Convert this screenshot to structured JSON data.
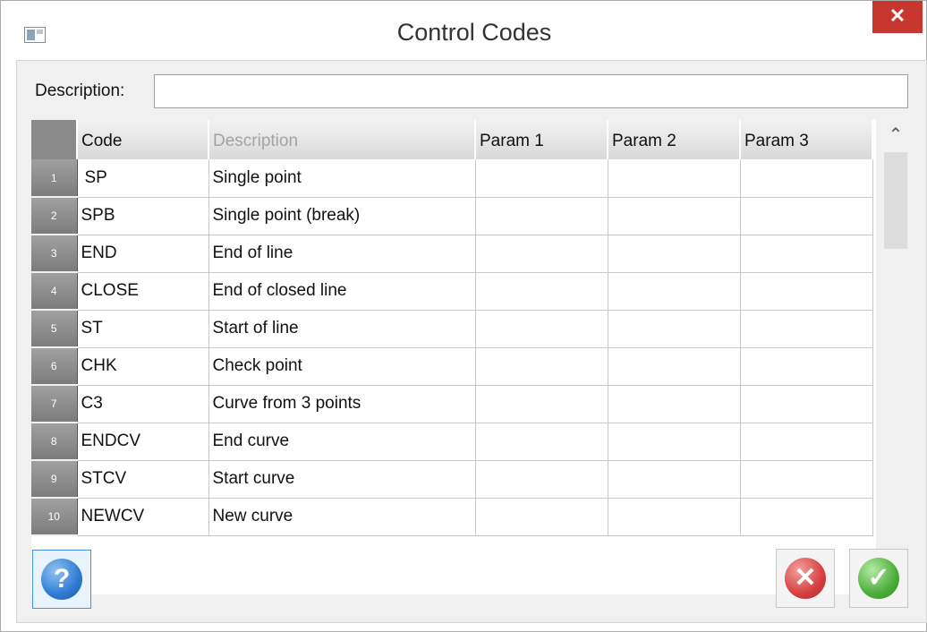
{
  "window": {
    "title": "Control Codes",
    "close_glyph": "✕"
  },
  "form": {
    "description_label": "Description:",
    "description_value": ""
  },
  "table": {
    "columns": [
      "",
      "Code",
      "Description",
      "Param 1",
      "Param 2",
      "Param 3"
    ],
    "rows": [
      {
        "num": "1",
        "code": "SP",
        "description": "Single point",
        "p1": "",
        "p2": "",
        "p3": ""
      },
      {
        "num": "2",
        "code": "SPB",
        "description": "Single point (break)",
        "p1": "",
        "p2": "",
        "p3": ""
      },
      {
        "num": "3",
        "code": "END",
        "description": "End of line",
        "p1": "",
        "p2": "",
        "p3": ""
      },
      {
        "num": "4",
        "code": "CLOSE",
        "description": "End of closed line",
        "p1": "",
        "p2": "",
        "p3": ""
      },
      {
        "num": "5",
        "code": "ST",
        "description": "Start of line",
        "p1": "",
        "p2": "",
        "p3": ""
      },
      {
        "num": "6",
        "code": "CHK",
        "description": "Check point",
        "p1": "",
        "p2": "",
        "p3": ""
      },
      {
        "num": "7",
        "code": "C3",
        "description": "Curve from 3 points",
        "p1": "",
        "p2": "",
        "p3": ""
      },
      {
        "num": "8",
        "code": "ENDCV",
        "description": "End curve",
        "p1": "",
        "p2": "",
        "p3": ""
      },
      {
        "num": "9",
        "code": "STCV",
        "description": "Start curve",
        "p1": "",
        "p2": "",
        "p3": ""
      },
      {
        "num": "10",
        "code": "NEWCV",
        "description": "New curve",
        "p1": "",
        "p2": "",
        "p3": ""
      }
    ]
  },
  "buttons": {
    "help_glyph": "?",
    "cancel_glyph": "✕",
    "ok_glyph": "✓"
  },
  "scroll": {
    "up_glyph": "⌃",
    "down_glyph": "⌄"
  },
  "colors": {
    "close_bg": "#c7372f",
    "help_blue": "#2f7bd3",
    "cancel_red": "#d64040",
    "ok_green": "#4cae3a"
  }
}
